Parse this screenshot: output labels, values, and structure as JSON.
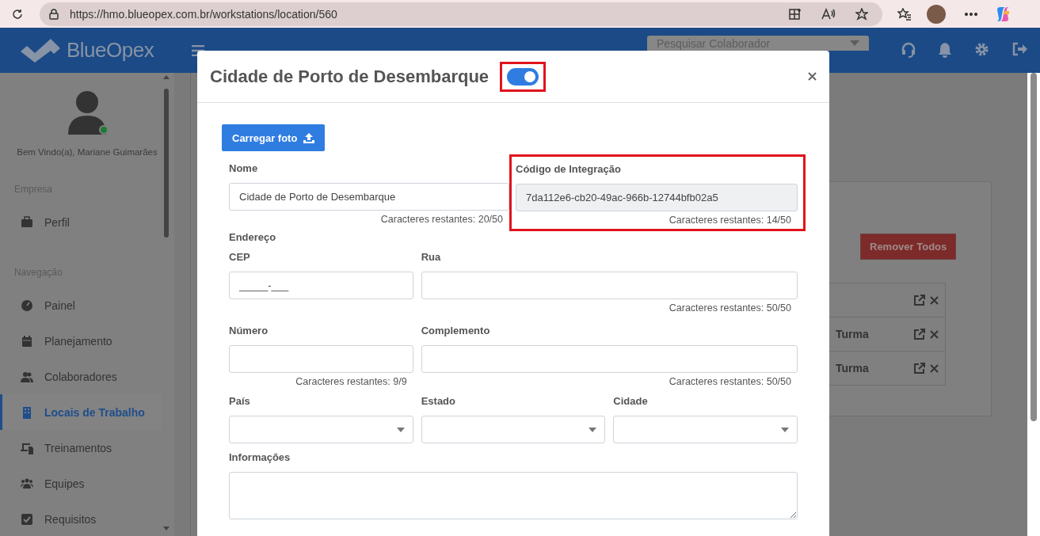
{
  "browser": {
    "url": "https://hmo.blueopex.com.br/workstations/location/560"
  },
  "header": {
    "logo": "BlueOpex",
    "search_placeholder": "Pesquisar Colaborador"
  },
  "sidebar": {
    "welcome": "Bem Vindo(a), Mariane Guimarães",
    "online": true,
    "sections": [
      {
        "title": "Empresa",
        "items": [
          {
            "label": "Perfil",
            "selected": false
          }
        ]
      },
      {
        "title": "Navegação",
        "items": [
          {
            "label": "Painel",
            "selected": false
          },
          {
            "label": "Planejamento",
            "selected": false
          },
          {
            "label": "Colaboradores",
            "selected": false
          },
          {
            "label": "Locais de Trabalho",
            "selected": true
          },
          {
            "label": "Treinamentos",
            "selected": false
          },
          {
            "label": "Equipes",
            "selected": false
          },
          {
            "label": "Requisitos",
            "selected": false
          }
        ]
      }
    ]
  },
  "background_card": {
    "remove_button": "Remover Todos",
    "rows": [
      {},
      {
        "text": "Turma"
      },
      {
        "text": "Turma"
      }
    ]
  },
  "modal": {
    "title": "Cidade de Porto de Desembarque",
    "active": {
      "on": true,
      "highlighted": true
    },
    "upload_button": "Carregar foto",
    "rows": [
      {
        "kind": "fields",
        "fields": [
          {
            "kind": "text",
            "label": "Nome",
            "value": "Cidade de Porto de Desembarque",
            "counter": "Caracteres restantes: 20/50",
            "disabled": false,
            "highlighted": false
          },
          {
            "kind": "text",
            "label": "Código de Integração",
            "value": "7da112e6-cb20-49ac-966b-12744bfb02a5",
            "counter": "Caracteres restantes: 14/50",
            "disabled": true,
            "highlighted": true
          }
        ]
      },
      {
        "kind": "heading",
        "text": "Endereço"
      },
      {
        "kind": "fields",
        "fields": [
          {
            "kind": "text",
            "label": "CEP",
            "value": "_____-___",
            "disabled": false,
            "highlighted": false
          },
          {
            "kind": "text",
            "label": "Rua",
            "counter": "Caracteres restantes: 50/50",
            "disabled": false,
            "highlighted": false
          }
        ]
      },
      {
        "kind": "fields",
        "fields": [
          {
            "kind": "text",
            "label": "Número",
            "counter": "Caracteres restantes: 9/9",
            "disabled": false,
            "highlighted": false
          },
          {
            "kind": "text",
            "label": "Complemento",
            "counter": "Caracteres restantes: 50/50",
            "disabled": false,
            "highlighted": false
          }
        ]
      },
      {
        "kind": "fields",
        "fields": [
          {
            "kind": "select",
            "label": "País"
          },
          {
            "kind": "select",
            "label": "Estado"
          },
          {
            "kind": "select",
            "label": "Cidade"
          }
        ]
      },
      {
        "kind": "fields",
        "fields": [
          {
            "kind": "textarea",
            "label": "Informações"
          }
        ]
      }
    ]
  }
}
